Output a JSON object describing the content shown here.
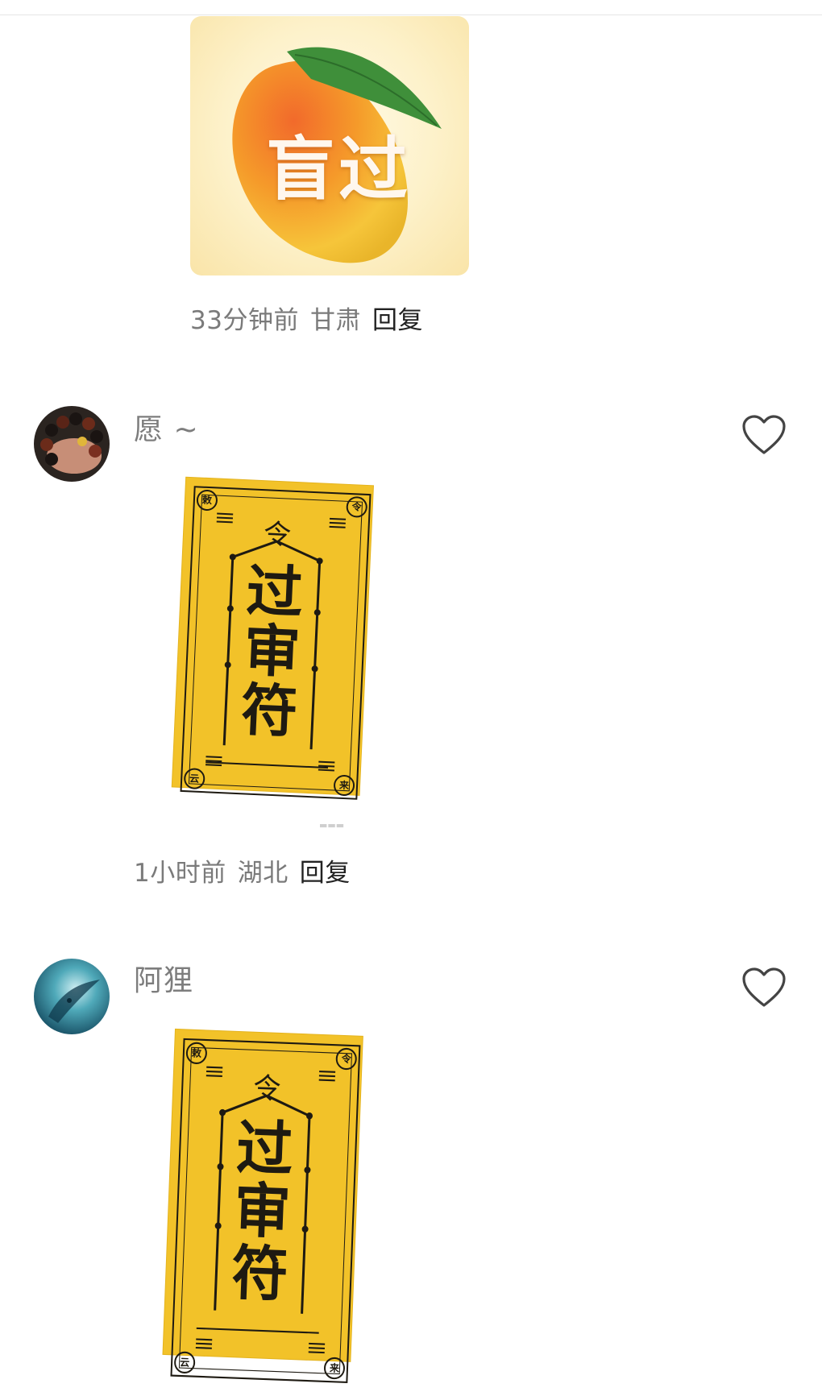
{
  "comments": [
    {
      "sticker_text": "盲过",
      "time": "33分钟前",
      "location": "甘肃",
      "reply_label": "回复"
    },
    {
      "username": "愿 ~",
      "sticker": {
        "top_char": "令",
        "main_chars": [
          "过",
          "审",
          "符"
        ],
        "seals": [
          "敕",
          "令",
          "云",
          "来"
        ]
      },
      "time": "1小时前",
      "location": "湖北",
      "reply_label": "回复"
    },
    {
      "username": "阿狸",
      "sticker": {
        "top_char": "令",
        "main_chars": [
          "过",
          "审",
          "符"
        ],
        "seals": [
          "敕",
          "令",
          "云",
          "来"
        ]
      }
    }
  ],
  "icons": {
    "like": "heart-outline-icon"
  },
  "colors": {
    "talisman_yellow": "#f2c229",
    "ink": "#1e1a12",
    "meta_gray": "#7a7a7a"
  }
}
